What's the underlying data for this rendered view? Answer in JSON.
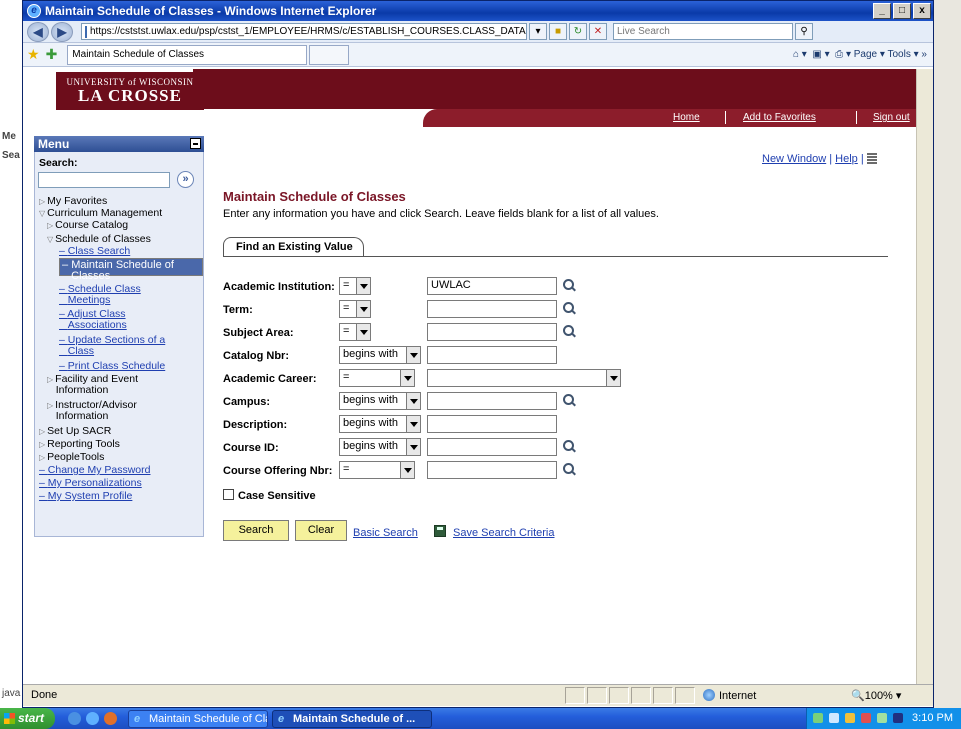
{
  "window": {
    "title": "Maintain Schedule of Classes - Windows Internet Explorer",
    "url": "https://cststst.uwlax.edu/psp/cstst_1/EMPLOYEE/HRMS/c/ESTABLISH_COURSES.CLASS_DATA.GBL",
    "live_search_placeholder": "Live Search",
    "tab_title": "Maintain Schedule of Classes",
    "command_bar": "Page ▾  Tools ▾"
  },
  "header": {
    "logo_line1": "UNIVERSITY of WISCONSIN",
    "logo_line2": "LA CROSSE",
    "links": [
      "Home",
      "Add to Favorites",
      "Sign out"
    ]
  },
  "menu": {
    "title": "Menu",
    "search_label": "Search:",
    "items": [
      {
        "label": "My Favorites"
      },
      {
        "label": "Curriculum Management"
      },
      {
        "label": "Course Catalog"
      },
      {
        "label": "Schedule of Classes"
      },
      {
        "label": "Class Search"
      },
      {
        "label": "Maintain Schedule of"
      },
      {
        "label": "Classes"
      },
      {
        "label": "Schedule Class"
      },
      {
        "label": "Meetings"
      },
      {
        "label": "Adjust Class"
      },
      {
        "label": "Associations"
      },
      {
        "label": "Update Sections of a"
      },
      {
        "label": "Class"
      },
      {
        "label": "Print Class Schedule"
      },
      {
        "label": "Facility and Event"
      },
      {
        "label": "Information"
      },
      {
        "label": "Instructor/Advisor"
      },
      {
        "label": "Information"
      },
      {
        "label": "Set Up SACR"
      },
      {
        "label": "Reporting Tools"
      },
      {
        "label": "PeopleTools"
      },
      {
        "label": "Change My Password"
      },
      {
        "label": "My Personalizations"
      },
      {
        "label": "My System Profile"
      }
    ]
  },
  "main": {
    "new_window": "New Window",
    "help": "Help",
    "title": "Maintain Schedule of Classes",
    "instructions": "Enter any information you have and click Search. Leave fields blank for a list of all values.",
    "tab_label": "Find an Existing Value",
    "fields": [
      {
        "label": "Academic Institution:",
        "op": "=",
        "value": "UWLAC"
      },
      {
        "label": "Term:",
        "op": "=",
        "value": ""
      },
      {
        "label": "Subject Area:",
        "op": "=",
        "value": ""
      },
      {
        "label": "Catalog Nbr:",
        "op": "begins with",
        "value": ""
      },
      {
        "label": "Academic Career:",
        "op": "=",
        "value": ""
      },
      {
        "label": "Campus:",
        "op": "begins with",
        "value": ""
      },
      {
        "label": "Description:",
        "op": "begins with",
        "value": ""
      },
      {
        "label": "Course ID:",
        "op": "begins with",
        "value": ""
      },
      {
        "label": "Course Offering Nbr:",
        "op": "=",
        "value": ""
      }
    ],
    "case_sensitive": "Case Sensitive",
    "search_button": "Search",
    "clear_button": "Clear",
    "basic_search": "Basic Search",
    "save_criteria": "Save Search Criteria"
  },
  "status": {
    "text": "Done",
    "zone": "Internet",
    "zoom": "100%"
  },
  "taskbar": {
    "start": "start",
    "tasks": [
      "Maintain Schedule of Cla...",
      "Maintain Schedule of ..."
    ],
    "clock": "3:10 PM"
  },
  "behind": {
    "left_labels": [
      "Me",
      "Sea",
      "java"
    ]
  }
}
